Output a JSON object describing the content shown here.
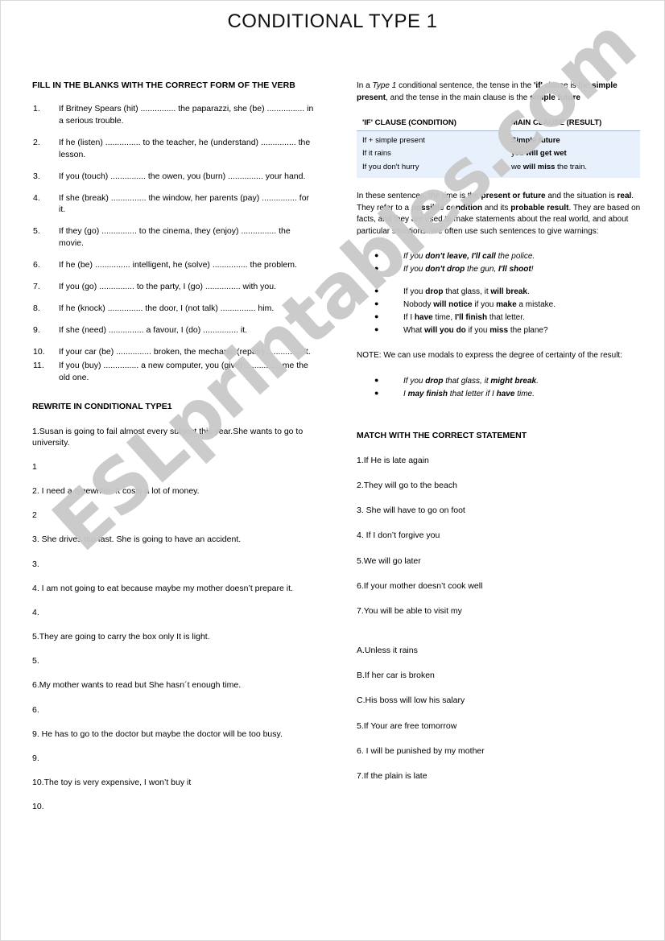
{
  "title": "CONDITIONAL TYPE 1",
  "watermark": "ESLprintables.com",
  "left": {
    "gapfill_heading": "FILL IN THE BLANKS WITH THE CORRECT FORM OF THE VERB",
    "gapfill_items": [
      {
        "num": "1.",
        "text": "If Britney Spears (hit) ............... the paparazzi, she (be) ................ in a serious trouble."
      },
      {
        "num": "2.",
        "text": "If he (listen) ............... to the teacher, he (understand) ............... the lesson."
      },
      {
        "num": "3.",
        "text": "If you (touch) ............... the owen, you (burn) ............... your hand."
      },
      {
        "num": "4.",
        "text": "If she (break) ............... the window, her parents (pay) ............... for it."
      },
      {
        "num": "5.",
        "text": "If they (go) ............... to the cinema, they (enjoy) ............... the movie."
      },
      {
        "num": "6.",
        "text": "If he (be) ............... intelligent, he (solve) ............... the problem."
      },
      {
        "num": "7.",
        "text": "If you (go) ............... to the party, I (go) ............... with you."
      },
      {
        "num": "8.",
        "text": "If he (knock) ............... the door, I (not talk) ............... him."
      },
      {
        "num": "9.",
        "text": "If she (need) ............... a favour, I (do) ............... it."
      },
      {
        "num": "10.",
        "text": "If your car (be) ............... broken, the mechanic (repair) ............... it."
      },
      {
        "num": "11.",
        "text": "If you (buy) ............... a new computer, you (give) ............... me the old one."
      }
    ],
    "rewrite_heading": "REWRITE IN CONDITIONAL TYPE1",
    "rewrite_items": [
      {
        "sentence": "1.Susan is going to fail almost every subject this year.She wants to go to university.",
        "answer": "1"
      },
      {
        "sentence": "2. I need a typewriter. It costs a lot of money.",
        "answer": "2"
      },
      {
        "sentence": "3. She drives too fast. She is going to have an accident.",
        "answer": "3."
      },
      {
        "sentence": "4. I am not going to eat because maybe my mother doesn’t prepare it.",
        "answer": "4."
      },
      {
        "sentence": "5.They are going to carry the box only It is light.",
        "answer": "5."
      },
      {
        "sentence": "6.My mother wants to read but She hasn´t enough time.",
        "answer": "6."
      },
      {
        "sentence": "9. He has to go to the doctor but maybe the doctor will be too busy.",
        "answer": "9."
      },
      {
        "sentence": "10.The toy is very expensive, I won’t buy it",
        "answer": "10."
      }
    ]
  },
  "right": {
    "intro": {
      "p1": "In a ",
      "p2": "Type 1",
      "p3": " conditional sentence, the tense in the ",
      "p4": "'if'",
      "p5": " clause is the ",
      "p6": "simple present",
      "p7": ", and the tense in the main clause is the ",
      "p8": "simple future"
    },
    "table": {
      "header_if": "'IF' CLAUSE (CONDITION)",
      "header_main": "MAIN CLAUSE (RESULT)",
      "rows": [
        {
          "if": "If + simple present",
          "main_plain": "",
          "main_bold": "Simple future",
          "main_tail": ""
        },
        {
          "if": "If it rains",
          "main_plain": "you ",
          "main_bold": "will get wet",
          "main_tail": ""
        },
        {
          "if": "If you don't hurry",
          "main_plain": "we ",
          "main_bold": "will miss",
          "main_tail": " the train."
        }
      ]
    },
    "explain": {
      "s1": "In these sentences, the time is the ",
      "s2": "present or future",
      "s3": " and the situation is ",
      "s4": "real",
      "s5": ". They refer to a ",
      "s6": "possible condition",
      "s7": " and its ",
      "s8": "probable result",
      "s9": ". They are based on facts, and they are used to make statements about the real world, and about particular situations. We often use such sentences to give warnings:"
    },
    "warnings": [
      {
        "a": "If you ",
        "b": "don't leave, I'll call",
        "c": " the police."
      },
      {
        "a": "If you ",
        "b": "don't drop",
        "c": " the gun, ",
        "d": "I'll shoot",
        "e": "!"
      }
    ],
    "examples": [
      {
        "a": "If you ",
        "b": "drop",
        "c": " that glass, it ",
        "d": "will break",
        "e": "."
      },
      {
        "a": "Nobody ",
        "b": "will notice",
        "c": " if you ",
        "d": "make",
        "e": " a mistake."
      },
      {
        "a": "If I ",
        "b": "have",
        "c": " time, ",
        "d": "I'll finish",
        "e": " that letter."
      },
      {
        "a": "What ",
        "b": "will you do",
        "c": " if you ",
        "d": "miss",
        "e": " the plane?"
      }
    ],
    "note_text": "NOTE: We can use modals to express the degree of certainty of the result:",
    "modals": [
      {
        "a": "If you ",
        "b": "drop",
        "c": " that glass, it ",
        "d": "might break",
        "e": "."
      },
      {
        "a": "I ",
        "b": "may finish",
        "c": " that letter if I ",
        "d": "have",
        "e": " time."
      }
    ],
    "match_heading": "MATCH WITH THE CORRECT STATEMENT",
    "match_left": [
      "1.If He is late again",
      "2.They will go to the beach",
      "3. She will have to go on foot",
      "4. If I don’t forgive you",
      "5.We will go later",
      "6.If your mother doesn’t cook well",
      "7.You will be able to visit my"
    ],
    "match_right": [
      "A.Unless it rains",
      "B.If her car is broken",
      "C.His boss will low his salary",
      "5.If Your are free tomorrow",
      "6. I will be punished by my mother",
      "7.If the plain is late"
    ]
  },
  "colors": {
    "table_fill": "#e7f0fb",
    "watermark": "#c9c9c9"
  }
}
